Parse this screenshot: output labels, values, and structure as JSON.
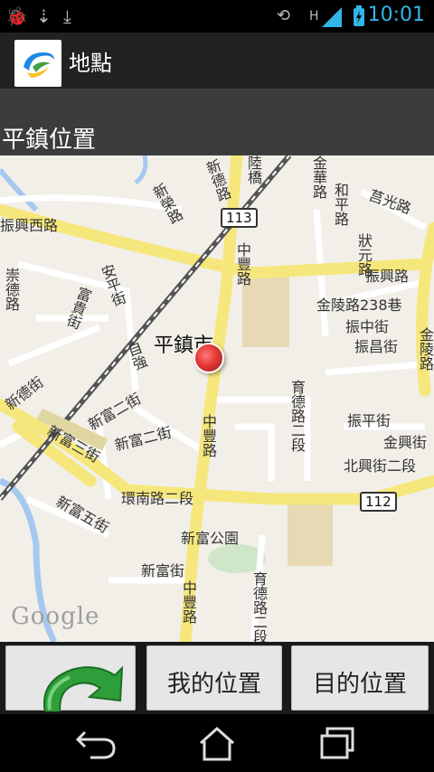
{
  "status_bar": {
    "time": "10:01",
    "network": "H"
  },
  "action_bar": {
    "title": "地點"
  },
  "location": {
    "title": "平鎮位置"
  },
  "map": {
    "roads": {
      "zhenxing_w": "振興西路",
      "zhenxing": "振興路",
      "xinde": "新德路",
      "luqiao": "陸橋",
      "jinhua": "金華路",
      "hoping": "和平路",
      "juguang": "莒光路",
      "zhuangyuan": "狀元路",
      "jinling238": "金陵路238巷",
      "zhenzhong": "振中街",
      "zhenchang": "振昌街",
      "jinling": "金陵路",
      "xinrong": "新榮路",
      "chongde": "崇德路",
      "fugui": "富貴街",
      "anping": "安平街",
      "xindejie": "新德街",
      "zhongfeng1": "中豐路",
      "zhongfeng2": "中豐路",
      "zhongfeng3": "中豐路",
      "yucai": "育德路二段",
      "yucai2": "育德路二段",
      "zhenping": "振平街",
      "jinxing": "金興街",
      "beixing": "北興街二段",
      "xinfu2": "新富二街",
      "xinfu2b": "新富二街",
      "xinfu5": "新富五街",
      "xinfu": "新富街",
      "huannan": "環南路二段",
      "ziqiang": "自強",
      "xinfu3": "新富三街"
    },
    "city_label": "平鎮市",
    "park": "新富公園",
    "shields": {
      "a": "113",
      "b": "112"
    },
    "attribution": "Google"
  },
  "buttons": {
    "back_icon": "green-curved-back-arrow",
    "my_location": "我的位置",
    "destination": "目的位置"
  },
  "nav": {
    "back": "back-icon",
    "home": "home-icon",
    "recent": "recent-apps-icon"
  },
  "colors": {
    "accent": "#33b5e5",
    "road_major": "#f6e77c",
    "map_bg": "#f2efe9"
  }
}
